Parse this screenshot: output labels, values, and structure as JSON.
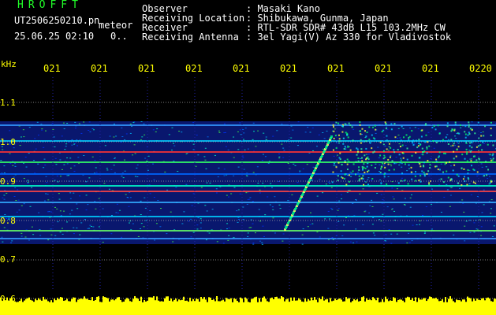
{
  "header": {
    "brand": "HROFFT",
    "filename": "UT2506250210.pn",
    "meteor": "meteor",
    "datetime": "25.06.25 02:10",
    "dots": "0..",
    "meta": [
      {
        "label": "Observer",
        "value": ": Masaki Kano"
      },
      {
        "label": "Receiving Location",
        "value": ": Shibukawa, Gunma, Japan"
      },
      {
        "label": "Receiver",
        "value": ": RTL-SDR SDR# 43dB L15 103.2MHz CW"
      },
      {
        "label": "Receiving Antenna",
        "value": ": 3el Yagi(V) Az 330 for Vladivostok"
      }
    ]
  },
  "axis": {
    "unit": "kHz",
    "y_labels": [
      "1.1",
      "1.0",
      "0.9",
      "0.8",
      "0.7",
      "0.6"
    ],
    "time_labels": [
      "021",
      "021",
      "021",
      "021",
      "021",
      "021",
      "021",
      "021",
      "021",
      "0220"
    ]
  },
  "colors": {
    "brand": "#21ff29",
    "axis": "#ffff00",
    "background": "#000000"
  }
}
